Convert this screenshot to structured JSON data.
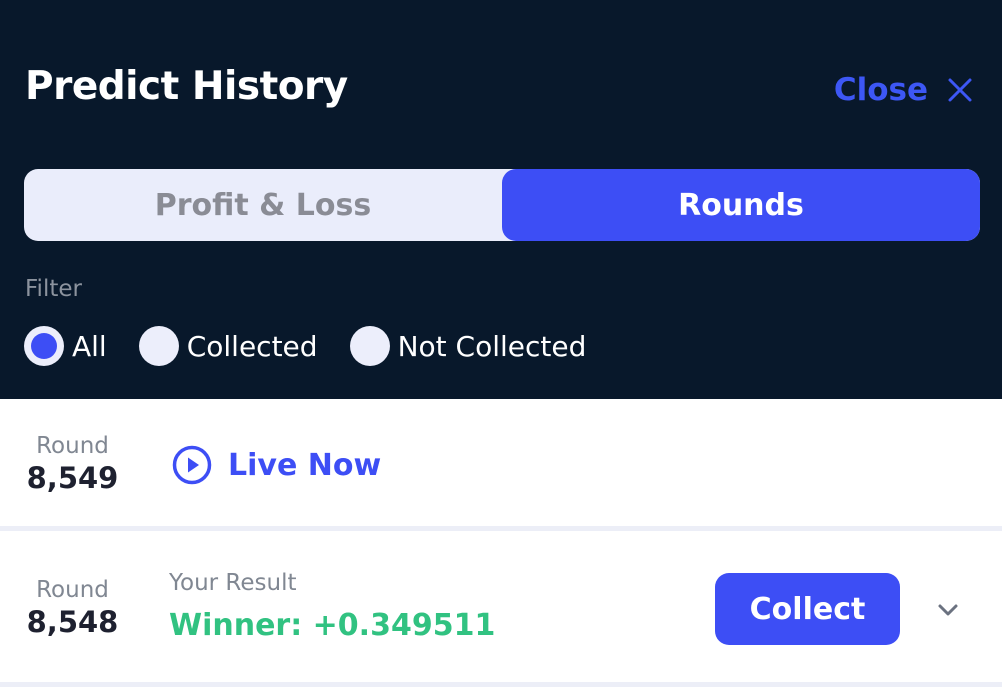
{
  "header": {
    "title": "Predict History",
    "close_label": "Close"
  },
  "tabs": [
    {
      "label": "Profit & Loss",
      "active": false
    },
    {
      "label": "Rounds",
      "active": true
    }
  ],
  "filter": {
    "label": "Filter",
    "options": [
      {
        "label": "All",
        "checked": true
      },
      {
        "label": "Collected",
        "checked": false
      },
      {
        "label": "Not Collected",
        "checked": false
      }
    ]
  },
  "rounds": [
    {
      "round_label": "Round",
      "round_number": "8,549",
      "status": "Live Now"
    },
    {
      "round_label": "Round",
      "round_number": "8,548",
      "result_label": "Your Result",
      "result_value": "Winner: +0.349511",
      "action_label": "Collect"
    }
  ],
  "colors": {
    "background_dark": "#08182b",
    "accent": "#3d4ef5",
    "winner": "#31c281"
  },
  "icons": {
    "close": "close-icon",
    "live": "play-circle-icon",
    "expand": "chevron-down-icon"
  }
}
